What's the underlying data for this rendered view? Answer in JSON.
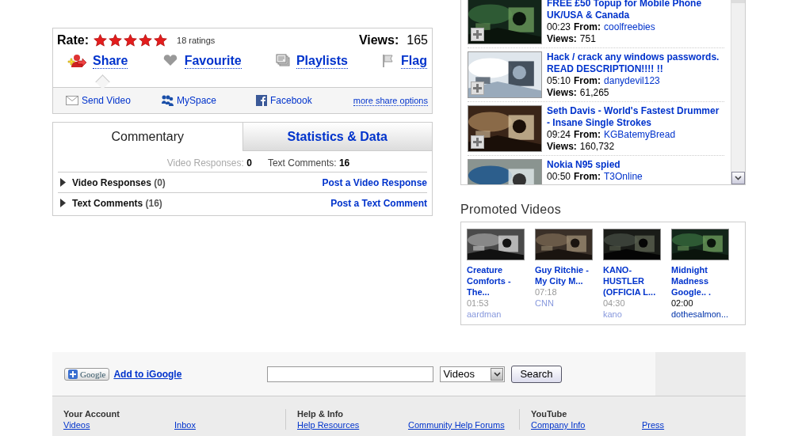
{
  "rating": {
    "label": "Rate:",
    "stars": 5,
    "count": "18 ratings"
  },
  "views": {
    "label": "Views:",
    "value": "165"
  },
  "actions": [
    {
      "label": "Share",
      "selected": true
    },
    {
      "label": "Favourite",
      "selected": false
    },
    {
      "label": "Playlists",
      "selected": false
    },
    {
      "label": "Flag",
      "selected": false
    }
  ],
  "share_options": [
    {
      "label": "Send Video"
    },
    {
      "label": "MySpace"
    },
    {
      "label": "Facebook"
    }
  ],
  "more_share": "more share options",
  "comment_tabs": [
    {
      "label": "Commentary",
      "selected": true
    },
    {
      "label": "Statistics & Data",
      "selected": false
    }
  ],
  "summary": [
    {
      "label": "Video Responses:",
      "value": "0",
      "dimmed": true
    },
    {
      "label": "Text Comments:",
      "value": "16",
      "dimmed": false
    }
  ],
  "sections": [
    {
      "title": "Video Responses",
      "count": "(0)",
      "expanded": false,
      "action": "Post a Video Response"
    },
    {
      "title": "Text Comments",
      "count": "(16)",
      "expanded": false,
      "action": "Post a Text Comment"
    }
  ],
  "related": [
    {
      "title": "FREE £50 Topup for Mobile Phone UK/USA & Canada",
      "duration": "00:23",
      "from_label": "From:",
      "user": "coolfreebies",
      "views_label": "Views:",
      "views": "751"
    },
    {
      "title": "Hack / crack any windows passwords. READ DESCRIPTION!!!! !!",
      "duration": "05:10",
      "from_label": "From:",
      "user": "danydevil123",
      "views_label": "Views:",
      "views": "61,265"
    },
    {
      "title": "Seth Davis - World's Fastest Drummer - Insane Single Strokes",
      "duration": "09:24",
      "from_label": "From:",
      "user": "KGBatemyBread",
      "views_label": "Views:",
      "views": "160,732"
    },
    {
      "title": "Nokia N95 spied",
      "duration": "00:50",
      "from_label": "From:",
      "user": "T3Online"
    }
  ],
  "promoted": {
    "title": "Promoted Videos",
    "items": [
      {
        "title": "Creature Comforts - The...",
        "duration": "01:53",
        "user": "aardman",
        "faded": true
      },
      {
        "title": "Guy Ritchie - My City M...",
        "duration": "07:18",
        "user": "CNN",
        "faded": true
      },
      {
        "title": "KANO- HUSTLER (OFFICIA L...",
        "duration": "04:30",
        "user": "kano",
        "faded": true
      },
      {
        "title": "Midnight Madness Google.. .",
        "duration": "02:00",
        "user": "dothesalmon...",
        "faded": false
      }
    ]
  },
  "footer": {
    "google_button": "Google",
    "add_link": "Add to iGoogle",
    "category": "Videos",
    "search_button": "Search",
    "columns": [
      {
        "heading": "Your Account",
        "links": [
          "Videos",
          "Inbox"
        ]
      },
      {
        "heading": "Help & Info",
        "links": [
          "Help Resources",
          "Community Help Forums"
        ]
      },
      {
        "heading": "YouTube",
        "links": [
          "Company Info",
          "Press"
        ]
      }
    ]
  }
}
